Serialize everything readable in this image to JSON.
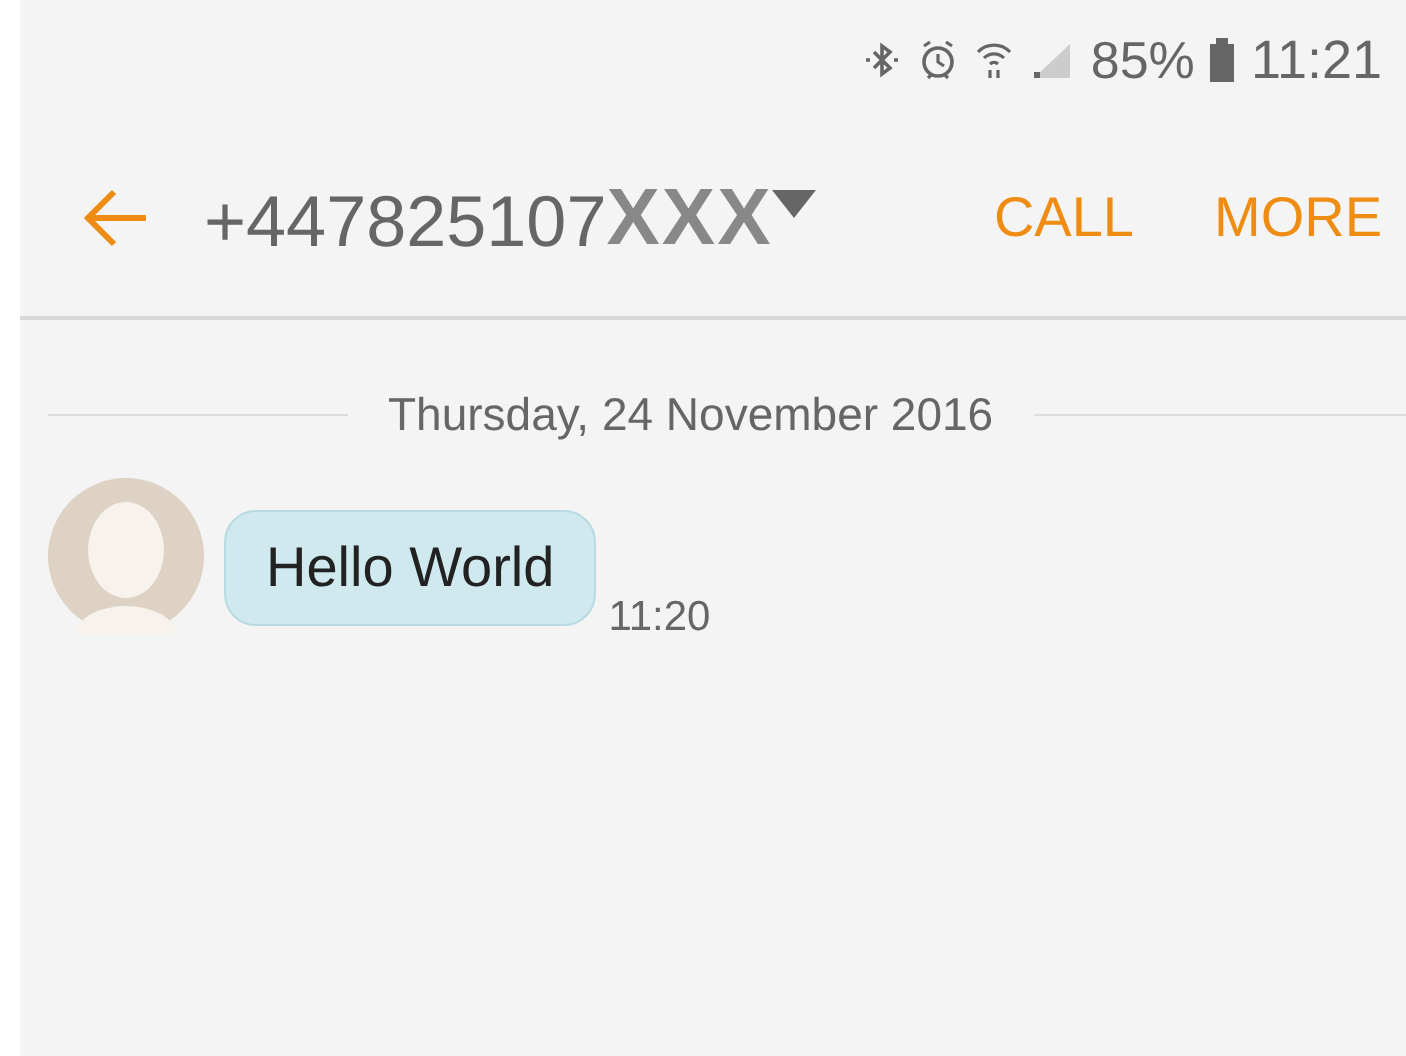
{
  "status_bar": {
    "battery": "85%",
    "time": "11:21"
  },
  "header": {
    "number": "+447825107",
    "masked_digits": "XXX",
    "actions": [
      "CALL",
      "MORE"
    ]
  },
  "date_divider": "Thursday, 24 November 2016",
  "messages": [
    {
      "kind": "incoming",
      "text": "Hello World",
      "time": "11:20"
    }
  ]
}
